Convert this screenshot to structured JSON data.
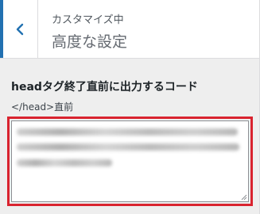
{
  "header": {
    "subtitle": "カスタマイズ中",
    "title": "高度な設定"
  },
  "control": {
    "label": "headタグ終了直前に出力するコード",
    "description": "</head>直前"
  },
  "colors": {
    "accent": "#2271b1",
    "highlight_border": "#d9232f"
  },
  "icons": {
    "back": "chevron-left-icon",
    "resize": "resize-grip-icon"
  }
}
